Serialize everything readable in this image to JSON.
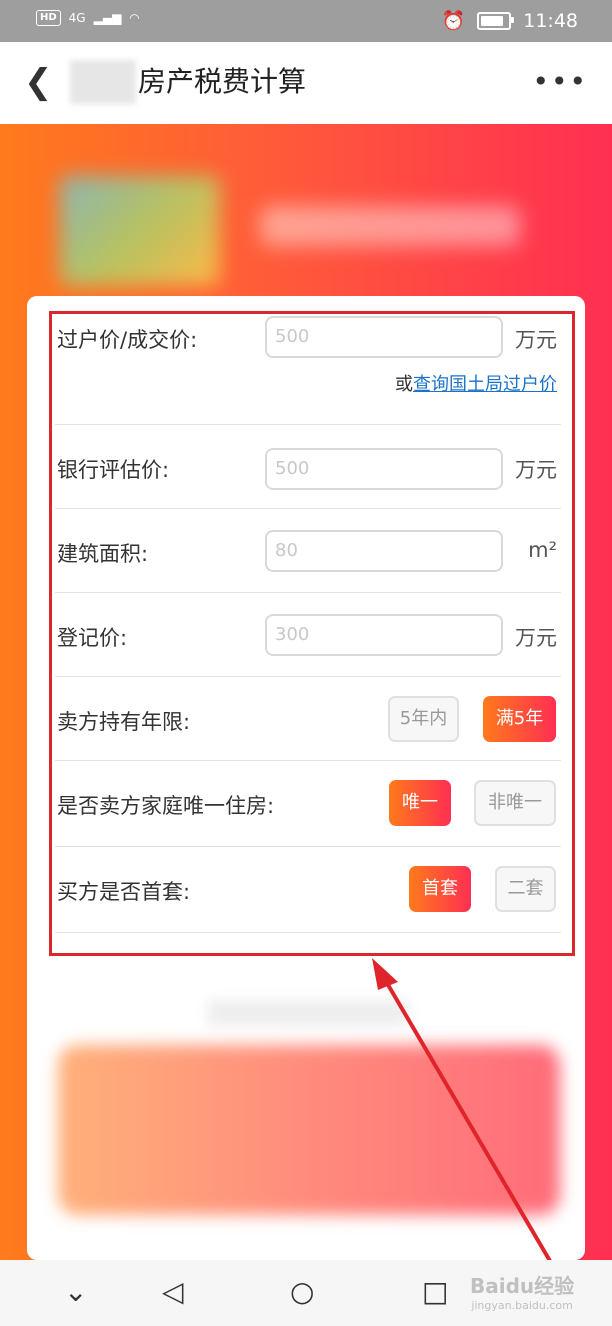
{
  "status": {
    "hd": "HD",
    "network": "4G",
    "time": "11:48",
    "battery_level": 0.85
  },
  "header": {
    "title": "房产税费计算",
    "back_icon": "chevron-left-icon",
    "more_icon": "more-icon"
  },
  "form": {
    "price_label": "过户价/成交价:",
    "price_placeholder": "500",
    "price_unit": "万元",
    "link_prefix": "或",
    "link_text": "查询国土局过户价",
    "eval_label": "银行评估价:",
    "eval_placeholder": "500",
    "eval_unit": "万元",
    "area_label": "建筑面积:",
    "area_placeholder": "80",
    "area_unit": "m²",
    "reg_label": "登记价:",
    "reg_placeholder": "300",
    "reg_unit": "万元",
    "years_label": "卖方持有年限:",
    "years_opt1": "5年内",
    "years_opt2": "满5年",
    "unique_label": "是否卖方家庭唯一住房:",
    "unique_opt1": "唯一",
    "unique_opt2": "非唯一",
    "first_label": "买方是否首套:",
    "first_opt1": "首套",
    "first_opt2": "二套"
  },
  "nav": {
    "down": "⌄",
    "back": "◁",
    "home": "○",
    "recent": "□"
  },
  "watermark": {
    "brand": "Baidu经验",
    "url": "jingyan.baidu.com"
  }
}
